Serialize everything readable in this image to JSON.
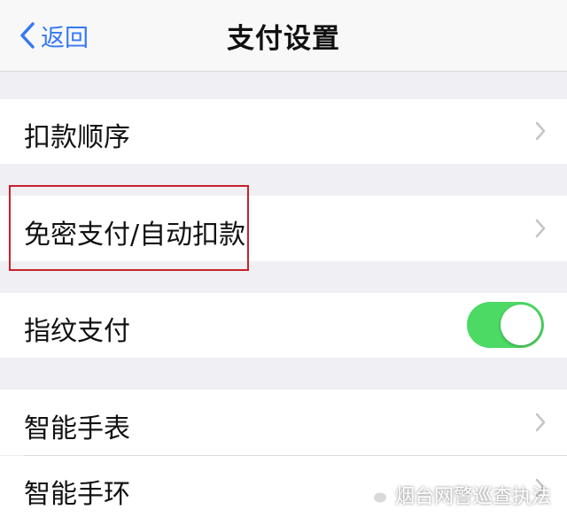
{
  "nav": {
    "back_label": "返回",
    "title": "支付设置"
  },
  "rows": {
    "deduction_order": "扣款顺序",
    "password_free": "免密支付/自动扣款",
    "fingerprint": "指纹支付",
    "smart_watch": "智能手表",
    "smart_band": "智能手环"
  },
  "fingerprint_toggle": {
    "on": true
  },
  "colors": {
    "accent": "#3478f6",
    "toggle_on": "#4cd964",
    "highlight": "#c8202a"
  },
  "watermark": {
    "text": "烟台网警巡查执法"
  }
}
